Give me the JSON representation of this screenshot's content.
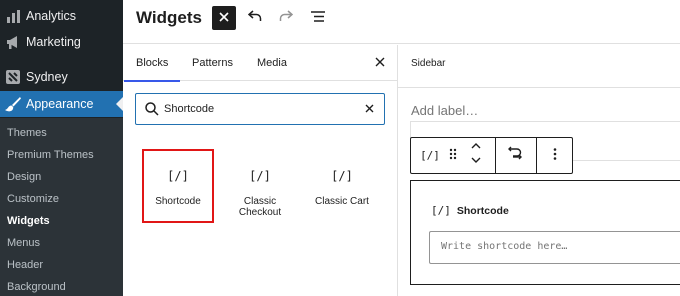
{
  "admin_menu": {
    "top_items": [
      {
        "label": "Analytics",
        "icon": "bar-chart-icon"
      },
      {
        "label": "Marketing",
        "icon": "megaphone-icon"
      },
      {
        "label": "Sydney",
        "icon": "sydney-theme-icon"
      },
      {
        "label": "Appearance",
        "icon": "paintbrush-icon"
      }
    ],
    "submenu": [
      "Themes",
      "Premium Themes",
      "Design",
      "Customize",
      "Widgets",
      "Menus",
      "Header",
      "Background"
    ],
    "current_submenu": "Widgets"
  },
  "header": {
    "title": "Widgets",
    "buttons": [
      "close-icon",
      "undo-icon",
      "redo-icon",
      "list-view-icon"
    ]
  },
  "inserter": {
    "tabs": [
      "Blocks",
      "Patterns",
      "Media"
    ],
    "active_tab": "Blocks",
    "search": {
      "value": "Shortcode",
      "placeholder": "Search"
    },
    "results": [
      {
        "label": "Shortcode",
        "icon": "[/]",
        "selected": true
      },
      {
        "label": "Classic Checkout",
        "icon": "[/]",
        "selected": false
      },
      {
        "label": "Classic Cart",
        "icon": "[/]",
        "selected": false
      }
    ]
  },
  "editor": {
    "area_title": "Sidebar",
    "add_label_placeholder": "Add label…",
    "block": {
      "icon": "[/]",
      "title": "Shortcode",
      "textarea_placeholder": "Write shortcode here…"
    },
    "toolbar": {
      "block_icon": "[/]"
    }
  },
  "colors": {
    "admin_bg": "#1d2327",
    "submenu_bg": "#2c3338",
    "accent": "#2271b1",
    "highlight_box": "#e11616",
    "tab_underline": "#3858e9"
  }
}
